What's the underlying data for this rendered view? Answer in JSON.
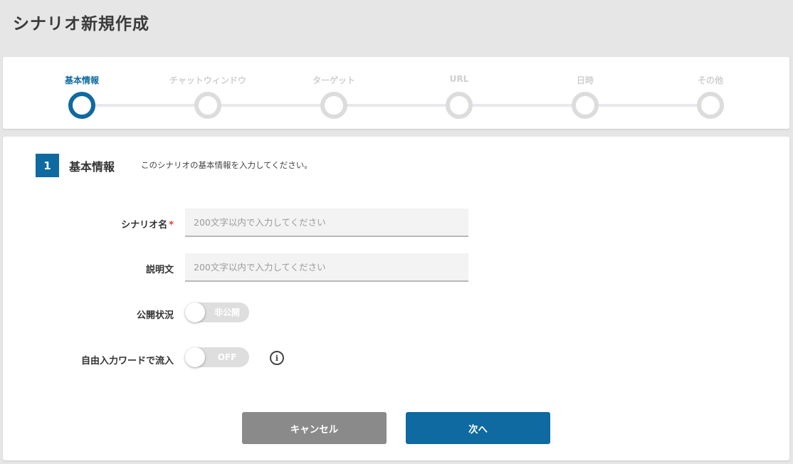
{
  "page": {
    "title": "シナリオ新規作成"
  },
  "stepper": {
    "steps": [
      {
        "label": "基本情報",
        "active": true
      },
      {
        "label": "チャットウィンドウ",
        "active": false
      },
      {
        "label": "ターゲット",
        "active": false
      },
      {
        "label": "URL",
        "active": false
      },
      {
        "label": "日時",
        "active": false
      },
      {
        "label": "その他",
        "active": false
      }
    ]
  },
  "section": {
    "number": "1",
    "title": "基本情報",
    "description": "このシナリオの基本情報を入力してください。"
  },
  "form": {
    "scenario_name": {
      "label": "シナリオ名",
      "required_mark": "*",
      "placeholder": "200文字以内で入力してください",
      "value": ""
    },
    "description": {
      "label": "説明文",
      "placeholder": "200文字以内で入力してください",
      "value": ""
    },
    "visibility": {
      "label": "公開状況",
      "toggle_text": "非公開"
    },
    "free_word": {
      "label": "自由入力ワードで流入",
      "toggle_text": "OFF",
      "info_icon": "info-icon"
    }
  },
  "buttons": {
    "cancel": "キャンセル",
    "next": "次へ"
  },
  "colors": {
    "accent": "#0e6aa0",
    "required": "#e23c3c",
    "cancel": "#8a8a8a"
  }
}
